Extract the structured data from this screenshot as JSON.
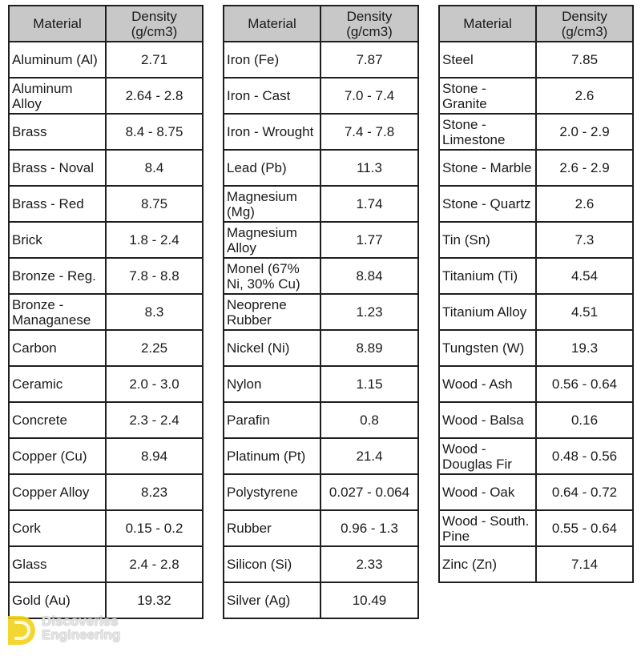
{
  "headers": {
    "material": "Material",
    "density_line1": "Density",
    "density_line2": "(g/cm3)"
  },
  "tables": [
    {
      "rows": [
        {
          "material": "Aluminum (Al)",
          "density": "2.71"
        },
        {
          "material": "Aluminum Alloy",
          "density": "2.64 - 2.8"
        },
        {
          "material": "Brass",
          "density": "8.4 - 8.75"
        },
        {
          "material": "Brass - Noval",
          "density": "8.4"
        },
        {
          "material": "Brass - Red",
          "density": "8.75"
        },
        {
          "material": "Brick",
          "density": "1.8 - 2.4"
        },
        {
          "material": "Bronze - Reg.",
          "density": "7.8 - 8.8"
        },
        {
          "material": "Bronze - Managanese",
          "density": "8.3"
        },
        {
          "material": "Carbon",
          "density": "2.25"
        },
        {
          "material": "Ceramic",
          "density": "2.0 - 3.0"
        },
        {
          "material": "Concrete",
          "density": "2.3 - 2.4"
        },
        {
          "material": "Copper (Cu)",
          "density": "8.94"
        },
        {
          "material": "Copper Alloy",
          "density": "8.23"
        },
        {
          "material": "Cork",
          "density": "0.15 - 0.2"
        },
        {
          "material": "Glass",
          "density": "2.4 - 2.8"
        },
        {
          "material": "Gold (Au)",
          "density": "19.32"
        }
      ]
    },
    {
      "rows": [
        {
          "material": "Iron (Fe)",
          "density": "7.87"
        },
        {
          "material": "Iron - Cast",
          "density": "7.0 - 7.4"
        },
        {
          "material": "Iron - Wrought",
          "density": "7.4 - 7.8"
        },
        {
          "material": "Lead (Pb)",
          "density": "11.3"
        },
        {
          "material": "Magnesium (Mg)",
          "density": "1.74"
        },
        {
          "material": "Magnesium Alloy",
          "density": "1.77"
        },
        {
          "material": "Monel (67% Ni, 30% Cu)",
          "density": "8.84"
        },
        {
          "material": "Neoprene Rubber",
          "density": "1.23"
        },
        {
          "material": "Nickel (Ni)",
          "density": "8.89"
        },
        {
          "material": "Nylon",
          "density": "1.15"
        },
        {
          "material": "Parafin",
          "density": "0.8"
        },
        {
          "material": "Platinum (Pt)",
          "density": "21.4"
        },
        {
          "material": "Polystyrene",
          "density": "0.027 - 0.064"
        },
        {
          "material": "Rubber",
          "density": "0.96 - 1.3"
        },
        {
          "material": "Silicon (Si)",
          "density": "2.33"
        },
        {
          "material": "Silver (Ag)",
          "density": "10.49"
        }
      ]
    },
    {
      "rows": [
        {
          "material": "Steel",
          "density": "7.85"
        },
        {
          "material": "Stone - Granite",
          "density": "2.6"
        },
        {
          "material": "Stone - Limestone",
          "density": "2.0 - 2.9"
        },
        {
          "material": "Stone - Marble",
          "density": "2.6 - 2.9"
        },
        {
          "material": "Stone - Quartz",
          "density": "2.6"
        },
        {
          "material": "Tin (Sn)",
          "density": "7.3"
        },
        {
          "material": "Titanium (Ti)",
          "density": "4.54"
        },
        {
          "material": "Titanium Alloy",
          "density": "4.51"
        },
        {
          "material": "Tungsten (W)",
          "density": "19.3"
        },
        {
          "material": "Wood - Ash",
          "density": "0.56 - 0.64"
        },
        {
          "material": "Wood - Balsa",
          "density": "0.16"
        },
        {
          "material": "Wood - Douglas Fir",
          "density": "0.48 - 0.56"
        },
        {
          "material": "Wood - Oak",
          "density": "0.64 - 0.72"
        },
        {
          "material": "Wood - South. Pine",
          "density": "0.55 - 0.64"
        },
        {
          "material": "Zinc (Zn)",
          "density": "7.14"
        }
      ]
    }
  ],
  "watermark": {
    "line1": "Discoveries",
    "line2": "Engineering",
    "logo_color": "#f2d21b"
  }
}
